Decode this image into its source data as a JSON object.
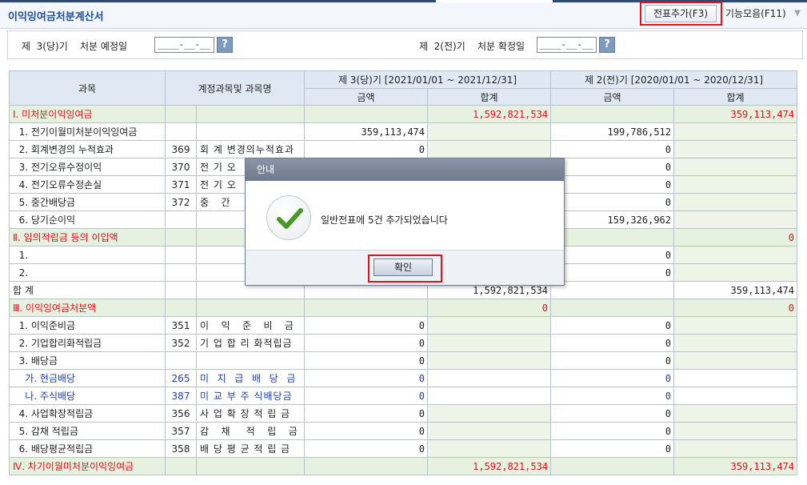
{
  "header": {
    "title": "이익잉여금처분계산서",
    "voucher_button": "전표추가(F3)",
    "function_button": "기능모음(F11)"
  },
  "filter": {
    "current_label": "제  3(당)기    처분 예정일",
    "current_date_placeholder": "____-__-__",
    "prior_label": "제  2(전)기    처분 확정일",
    "prior_date_placeholder": "____-__-__",
    "help_label": "?"
  },
  "table": {
    "headers": {
      "subject": "과목",
      "account": "계정과목및 과목명",
      "current_period": "제  3(당)기 [2021/01/01 ~ 2021/12/31]",
      "prior_period": "제  2(전)기 [2020/01/01 ~ 2020/12/31]",
      "amount": "금액",
      "total": "합계"
    },
    "rows": [
      {
        "type": "sec",
        "subject": "Ⅰ. 미처분이익잉여금",
        "code": "",
        "account": "",
        "c_amt": "",
        "c_tot": "1,592,821,534",
        "p_amt": "",
        "p_tot": "359,113,474"
      },
      {
        "type": "item",
        "subject": "  1. 전기이월미처분이익잉여금",
        "code": "",
        "account": "",
        "c_amt": "359,113,474",
        "c_tot": "",
        "p_amt": "199,786,512",
        "p_tot": ""
      },
      {
        "type": "item",
        "subject": "  2. 회계변경의 누적효과",
        "code": "369",
        "account": "회 계 변경의누적효과",
        "c_amt": "0",
        "c_tot": "",
        "p_amt": "0",
        "p_tot": ""
      },
      {
        "type": "item",
        "subject": "  3. 전기오류수정이익",
        "code": "370",
        "account": "전 기 오",
        "c_amt": "",
        "c_tot": "",
        "p_amt": "0",
        "p_tot": ""
      },
      {
        "type": "item",
        "subject": "  4. 전기오류수정손실",
        "code": "371",
        "account": "전 기 오",
        "c_amt": "",
        "c_tot": "",
        "p_amt": "0",
        "p_tot": ""
      },
      {
        "type": "item",
        "subject": "  5. 중간배당금",
        "code": "372",
        "account": "중   간",
        "c_amt": "",
        "c_tot": "",
        "p_amt": "0",
        "p_tot": ""
      },
      {
        "type": "item",
        "subject": "  6. 당기순이익",
        "code": "",
        "account": "",
        "c_amt": "",
        "c_tot": "",
        "p_amt": "159,326,962",
        "p_tot": ""
      },
      {
        "type": "sec",
        "subject": "Ⅱ. 임의적립금 등의 이입액",
        "code": "",
        "account": "",
        "c_amt": "",
        "c_tot": "",
        "p_amt": "",
        "p_tot": "0"
      },
      {
        "type": "item",
        "subject": "  1.",
        "code": "",
        "account": "",
        "c_amt": "",
        "c_tot": "",
        "p_amt": "0",
        "p_tot": ""
      },
      {
        "type": "item",
        "subject": "  2.",
        "code": "",
        "account": "",
        "c_amt": "",
        "c_tot": "",
        "p_amt": "0",
        "p_tot": ""
      },
      {
        "type": "total",
        "subject": "합 계",
        "code": "",
        "account": "",
        "c_amt": "",
        "c_tot": "1,592,821,534",
        "p_amt": "",
        "p_tot": "359,113,474"
      },
      {
        "type": "sec",
        "subject": "Ⅲ. 이익잉여금처분액",
        "code": "",
        "account": "",
        "c_amt": "",
        "c_tot": "0",
        "p_amt": "",
        "p_tot": "0"
      },
      {
        "type": "item",
        "subject": "  1. 이익준비금",
        "code": "351",
        "account": "이   익   준   비   금",
        "c_amt": "0",
        "c_tot": "",
        "p_amt": "0",
        "p_tot": ""
      },
      {
        "type": "item",
        "subject": "  2. 기업합리화적립금",
        "code": "352",
        "account": "기 업 합 리 화적립금",
        "c_amt": "0",
        "c_tot": "",
        "p_amt": "0",
        "p_tot": ""
      },
      {
        "type": "item",
        "subject": "  3. 배당금",
        "code": "",
        "account": "",
        "c_amt": "0",
        "c_tot": "",
        "p_amt": "0",
        "p_tot": ""
      },
      {
        "type": "blue",
        "subject": "    가. 현금배당",
        "code": "265",
        "account": "미  지  급  배  당  금",
        "c_amt": "0",
        "c_tot": "",
        "p_amt": "0",
        "p_tot": ""
      },
      {
        "type": "blue",
        "subject": "    나. 주식배당",
        "code": "387",
        "account": "미 교 부 주 식배당금",
        "c_amt": "0",
        "c_tot": "",
        "p_amt": "0",
        "p_tot": ""
      },
      {
        "type": "item",
        "subject": "  4. 사업확장적립금",
        "code": "356",
        "account": "사 업 확 장 적 립 금",
        "c_amt": "0",
        "c_tot": "",
        "p_amt": "0",
        "p_tot": ""
      },
      {
        "type": "item",
        "subject": "  5. 감채 적립금",
        "code": "357",
        "account": "감   채    적   립   금",
        "c_amt": "0",
        "c_tot": "",
        "p_amt": "0",
        "p_tot": ""
      },
      {
        "type": "item",
        "subject": "  6. 배당평균적립금",
        "code": "358",
        "account": "배 당 평 균 적 립 금",
        "c_amt": "0",
        "c_tot": "",
        "p_amt": "0",
        "p_tot": ""
      },
      {
        "type": "sec",
        "subject": "Ⅳ. 차기이월미처분이익잉여금",
        "code": "",
        "account": "",
        "c_amt": "",
        "c_tot": "1,592,821,534",
        "p_amt": "",
        "p_tot": "359,113,474"
      }
    ]
  },
  "dialog": {
    "title": "안내",
    "message": "일반전표에 5건 추가되었습니다",
    "ok_label": "확인",
    "icon": "check-icon"
  },
  "colors": {
    "accent_red": "#e0121c",
    "title_blue": "#1d4fa0",
    "section_green": "#e6f2df",
    "header_blue": "#dfe8f3"
  }
}
